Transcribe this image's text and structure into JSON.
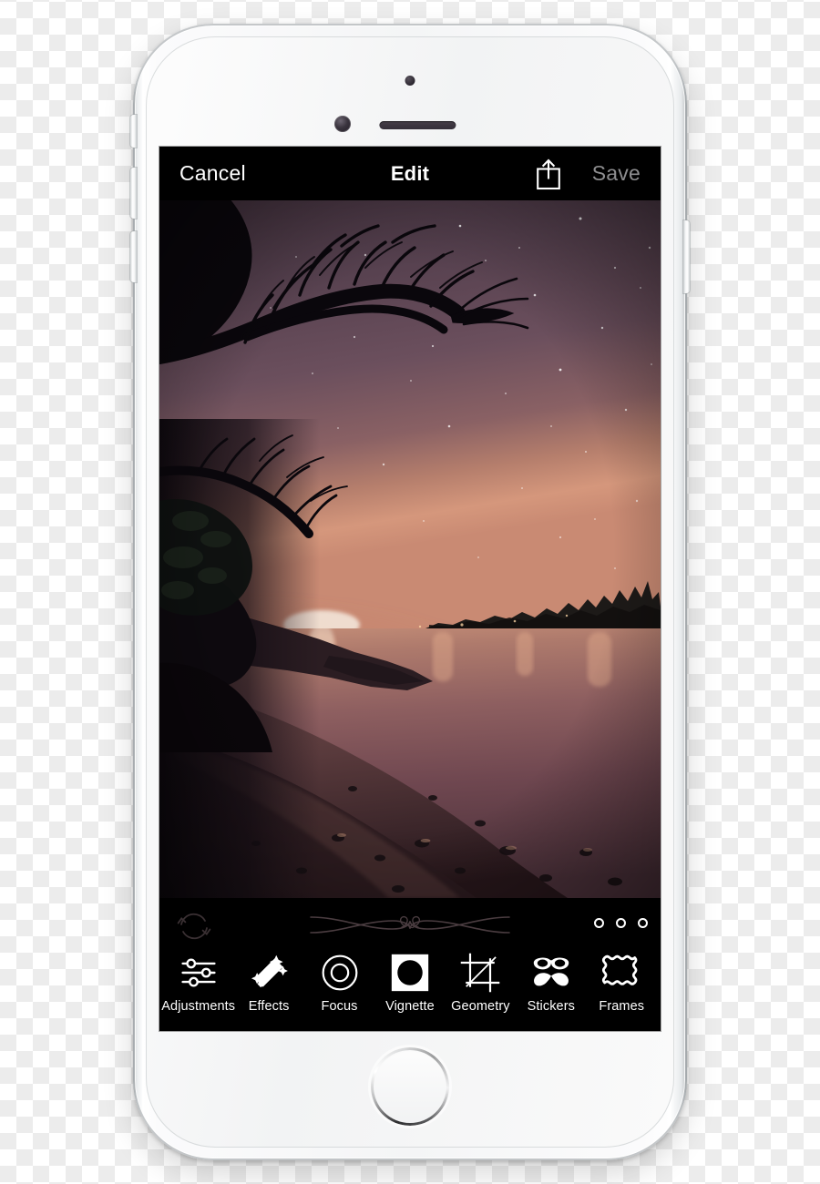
{
  "device": {
    "name": "iPhone 6 Silver",
    "body_color": "#f4f5f6",
    "screen_bg": "#000000",
    "controls": {
      "mute_switch": "mute-switch",
      "volume_up": "volume-up-button",
      "volume_down": "volume-down-button",
      "power": "power-button",
      "home": "home-button",
      "front_camera": "front-camera",
      "earpiece": "earpiece-speaker",
      "proximity_sensor": "proximity-sensor"
    }
  },
  "nav": {
    "cancel_label": "Cancel",
    "title": "Edit",
    "share_icon": "share-icon",
    "save_label": "Save",
    "cancel_color": "#ffffff",
    "title_color": "#ffffff",
    "save_color": "#8d8d8f"
  },
  "photo": {
    "description": "Starry night sky over a lake at sunset with silhouetted tree branches, rocky shoreline and sandy beach",
    "sky_top_color": "#4f3a48",
    "sky_mid_color": "#6e5160",
    "sunset_glow_color": "#d9937a",
    "sun_core_color": "#efd8c6",
    "water_color": "#7a5156",
    "beach_color": "#50343a",
    "foliage_color": "#120d14"
  },
  "tool_bar": {
    "undo_icon": "undo-refresh-icon",
    "ornament": "decorative-flourish",
    "page_dots_count": 3,
    "tools": [
      {
        "label": "Adjustments",
        "icon": "sliders-icon",
        "selected": false
      },
      {
        "label": "Effects",
        "icon": "magic-wand-icon",
        "selected": false
      },
      {
        "label": "Focus",
        "icon": "concentric-circles-icon",
        "selected": false
      },
      {
        "label": "Vignette",
        "icon": "vignette-icon",
        "selected": true
      },
      {
        "label": "Geometry",
        "icon": "crop-icon",
        "selected": false
      },
      {
        "label": "Stickers",
        "icon": "glasses-mustache-icon",
        "selected": false
      },
      {
        "label": "Frames",
        "icon": "wavy-frame-icon",
        "selected": false
      }
    ]
  }
}
